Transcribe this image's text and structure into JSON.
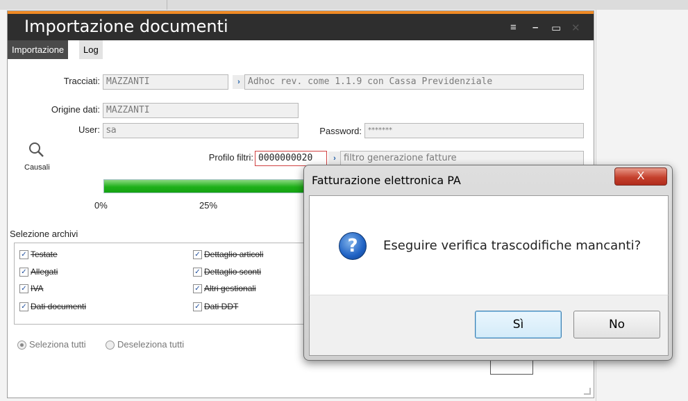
{
  "window": {
    "title": "Importazione documenti",
    "controls": {
      "menu": "≡",
      "minimize": "–",
      "maximize": "▭",
      "close": "✕"
    }
  },
  "tabs": [
    {
      "label": "Importazione",
      "active": true
    },
    {
      "label": "Log",
      "active": false
    }
  ],
  "form": {
    "tracciati_label": "Tracciati:",
    "tracciati_value": "MAZZANTI",
    "tracciati_desc": "Adhoc rev. come 1.1.9 con Cassa Previdenziale",
    "origine_label": "Origine dati:",
    "origine_value": "MAZZANTI",
    "user_label": "User:",
    "user_value": "sa",
    "password_label": "Password:",
    "password_value": "*******",
    "profilo_label": "Profilo filtri:",
    "profilo_value": "0000000020",
    "profilo_desc": "filtro generazione fatture",
    "causali_label": "Causali"
  },
  "progress": {
    "ticks": [
      "0%",
      "25%"
    ],
    "fill_fraction": 1.0
  },
  "archivi": {
    "title": "Selezione archivi",
    "items": [
      "Testate",
      "Allegati",
      "IVA",
      "Dati documenti",
      "Dettaglio articoli",
      "Dettaglio sconti",
      "Altri gestionali",
      "Dati DDT"
    ]
  },
  "selection": {
    "select_all": "Seleziona tutti",
    "deselect_all": "Deseleziona tutti"
  },
  "dialog": {
    "title": "Fatturazione elettronica PA",
    "message": "Eseguire verifica trascodifiche mancanti?",
    "yes": "Sì",
    "no": "No",
    "close": "X"
  },
  "colors": {
    "accent": "#f08a24",
    "titlebar": "#2e2e2e",
    "progress": "#1fb01a"
  }
}
